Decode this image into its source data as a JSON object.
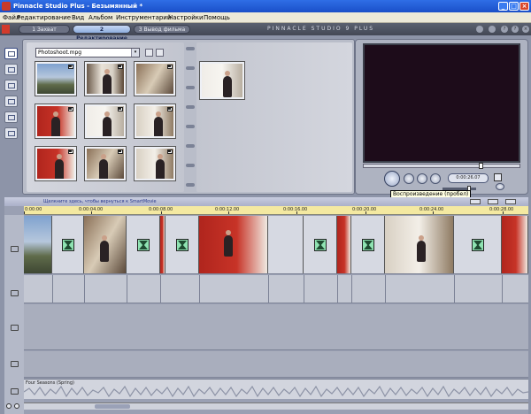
{
  "window": {
    "title": "Pinnacle Studio Plus - Безымянный *",
    "minimize": "_",
    "maximize": "□",
    "close": "×"
  },
  "menu": [
    "Файл",
    "Редактирование",
    "Вид",
    "Альбом",
    "Инструментарий",
    "Настройки",
    "Помощь"
  ],
  "tabs": [
    {
      "label": "1 Захват"
    },
    {
      "label": "2 Редактирование"
    },
    {
      "label": "3 Вывод фильма"
    }
  ],
  "brand": "PINNACLE STUDIO 9 PLUS",
  "toolbar_icons": [
    "?",
    "?",
    "×"
  ],
  "album": {
    "file_select": "Photoshoot.mpg",
    "arrow": "▾"
  },
  "preview": {
    "timecode": "0:00:26.07",
    "tooltip": "Воспроизведение (пробел)"
  },
  "timeline": {
    "hint": "Щелкните здесь, чтобы вернуться к SmartMovie",
    "ruler": [
      "0:00:00",
      "0:00:04.00",
      "0:00:08.00",
      "0:00:12.00",
      "0:00:16.00",
      "0:00:20.00",
      "0:00:24.00",
      "0:00:28.00"
    ],
    "audio_label": "Four Seasons (Spring)"
  }
}
